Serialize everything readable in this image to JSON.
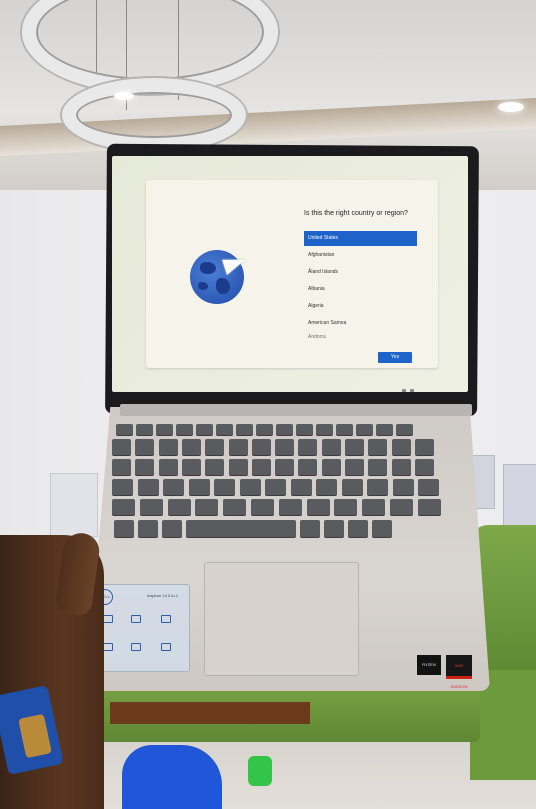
{
  "setup_screen": {
    "question": "Is this the right country or region?",
    "countries": [
      "United States",
      "Afghanistan",
      "Åland Islands",
      "Albania",
      "Algeria",
      "American Samoa",
      "Andorra"
    ],
    "selected": "United States",
    "yes_button": "Yes"
  },
  "laptop": {
    "brand": "DELL",
    "model": "Inspiron 14 2-in-1",
    "badge_1": "RYZEN",
    "badge_2": "AMD RADEON"
  },
  "colors": {
    "accent": "#1d63c9",
    "dialog_bg": "#f6f4ea",
    "keys": "#5a5b5f",
    "sofa": "#6e9a3e",
    "bag": "#1f57d8"
  },
  "icons": [
    "globe-icon",
    "paper-plane-icon"
  ]
}
